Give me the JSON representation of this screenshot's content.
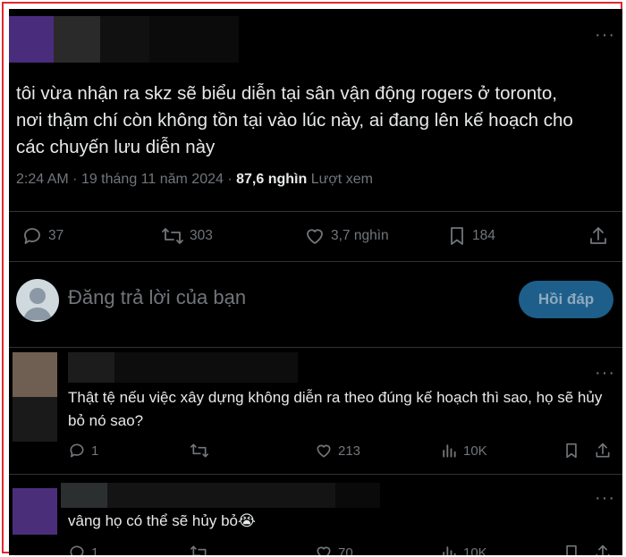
{
  "post": {
    "text": "tôi vừa nhận ra skz sẽ biểu diễn tại sân vận động rogers ở toronto, nơi thậm chí còn không tồn tại vào lúc này, ai đang lên kế hoạch cho các chuyến lưu diễn này",
    "time": "2:24 AM",
    "sep": "·",
    "date": "19 tháng 11 năm 2024",
    "views_count": "87,6 nghìn",
    "views_label": "Lượt xem",
    "replies": "37",
    "reposts": "303",
    "likes": "3,7 nghìn",
    "bookmarks": "184"
  },
  "compose": {
    "placeholder": "Đăng trả lời của bạn",
    "button": "Hồi đáp"
  },
  "replies": [
    {
      "text": "Thật tệ nếu việc xây dựng không diễn ra theo đúng kế hoạch thì sao, họ sẽ hủy bỏ nó sao?",
      "replies": "1",
      "likes": "213",
      "views": "10K",
      "avatar_color": "#6f5e52"
    },
    {
      "text": "vâng họ có thể sẽ hủy bỏ😭",
      "replies": "1",
      "likes": "70",
      "views": "10K",
      "avatar_color": "#4b2e7a"
    }
  ],
  "colors": {
    "background": "#000000",
    "text": "#e7e9ea",
    "muted": "#71767b",
    "divider": "#2f3336",
    "reply_button": "#1d5f8a",
    "frame": "#e0282e"
  },
  "icons": [
    "more-icon",
    "reply-icon",
    "repost-icon",
    "like-icon",
    "bookmark-icon",
    "share-icon",
    "views-icon",
    "person-icon"
  ]
}
